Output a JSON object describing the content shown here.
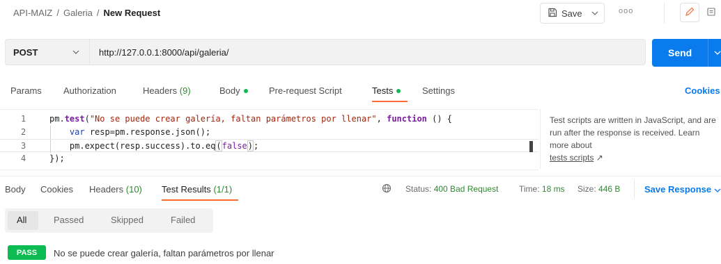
{
  "breadcrumb": {
    "collection": "API-MAIZ",
    "folder": "Galeria",
    "current": "New Request",
    "sep": "/"
  },
  "toolbar": {
    "save_label": "Save",
    "more": "ooo",
    "save_icon": "save-icon",
    "edit_icon": "pencil-icon",
    "comment_icon": "comment-icon"
  },
  "request": {
    "method": "POST",
    "url": "http://127.0.0.1:8000/api/galeria/",
    "send_label": "Send"
  },
  "tabs": [
    {
      "label": "Params"
    },
    {
      "label": "Authorization"
    },
    {
      "label": "Headers",
      "count": "(9)"
    },
    {
      "label": "Body"
    },
    {
      "label": "Pre-request Script"
    },
    {
      "label": "Tests"
    },
    {
      "label": "Settings"
    }
  ],
  "cookies_label": "Cookies",
  "editor": {
    "line_numbers": [
      "1",
      "2",
      "3",
      "4"
    ],
    "line1": {
      "pm": "pm.",
      "test": "test",
      "open": "(",
      "str": "\"No se puede crear galería, faltan parámetros por llenar\"",
      "comma": ", ",
      "function": "function",
      "rest": " () {"
    },
    "line2": {
      "indent": "    ",
      "var": "var",
      "rest": " resp=pm.response.json();"
    },
    "line3": {
      "indent": "    ",
      "pre": "pm.expect(resp.success).to.eq",
      "open": "(",
      "false": "false",
      "close": ")",
      "end": ";"
    },
    "line4": {
      "text": "});"
    }
  },
  "help": {
    "text": "Test scripts are written in JavaScript, and are run after the response is received. Learn more about",
    "link": "tests scripts",
    "link_icon": "↗"
  },
  "response_tabs": [
    {
      "label": "Body"
    },
    {
      "label": "Cookies"
    },
    {
      "label": "Headers",
      "count": "(10)"
    },
    {
      "label": "Test Results",
      "count": "(1/1)"
    }
  ],
  "status": {
    "status_label": "Status:",
    "status_value": "400 Bad Request",
    "time_label": "Time:",
    "time_value": "18 ms",
    "size_label": "Size:",
    "size_value": "446 B",
    "save_response": "Save Response"
  },
  "filters": [
    "All",
    "Passed",
    "Skipped",
    "Failed"
  ],
  "result": {
    "badge": "PASS",
    "text": "No se puede crear galería, faltan parámetros por llenar"
  },
  "colors": {
    "accent": "#097bed",
    "tab_indicator": "#ff6c37",
    "pass": "#0cbb52",
    "status_ok": "#2f8a2f"
  }
}
